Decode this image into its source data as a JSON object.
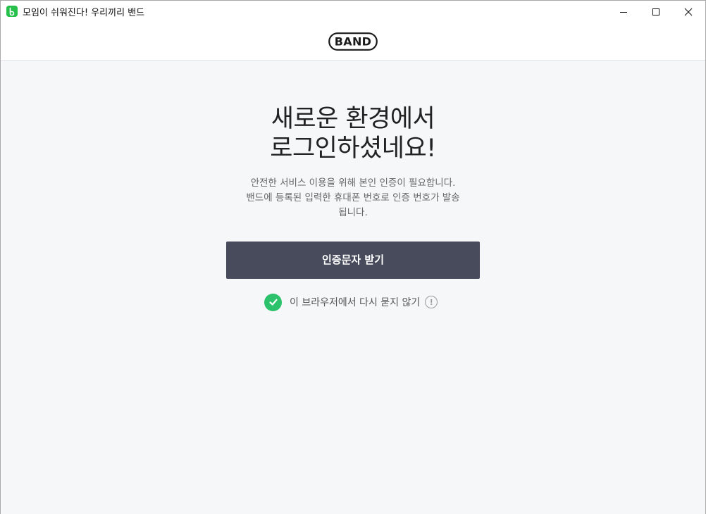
{
  "window": {
    "title": "모임이 쉬워진다! 우리끼리 밴드",
    "controls": [
      "minimize-icon",
      "maximize-icon",
      "close-icon"
    ]
  },
  "header": {
    "logo_text": "BAND"
  },
  "main": {
    "headline_line1": "새로운 환경에서",
    "headline_line2": "로그인하셨네요!",
    "description_line1": "안전한 서비스 이용을 위해 본인 인증이 필요합니다.",
    "description_line2": "밴드에 등록된 입력한 휴대폰 번호로 인증 번호가 발송",
    "description_line3": "됩니다.",
    "receive_sms_button": "인증문자 받기",
    "remember_browser_label": "이 브라우저에서 다시 묻지 않기",
    "remember_checked": true,
    "info_icon": "!"
  },
  "colors": {
    "button_bg": "#474b5c",
    "check_green": "#2bc26b",
    "app_icon_green": "#27c04a",
    "content_bg": "#f6f7f9"
  }
}
